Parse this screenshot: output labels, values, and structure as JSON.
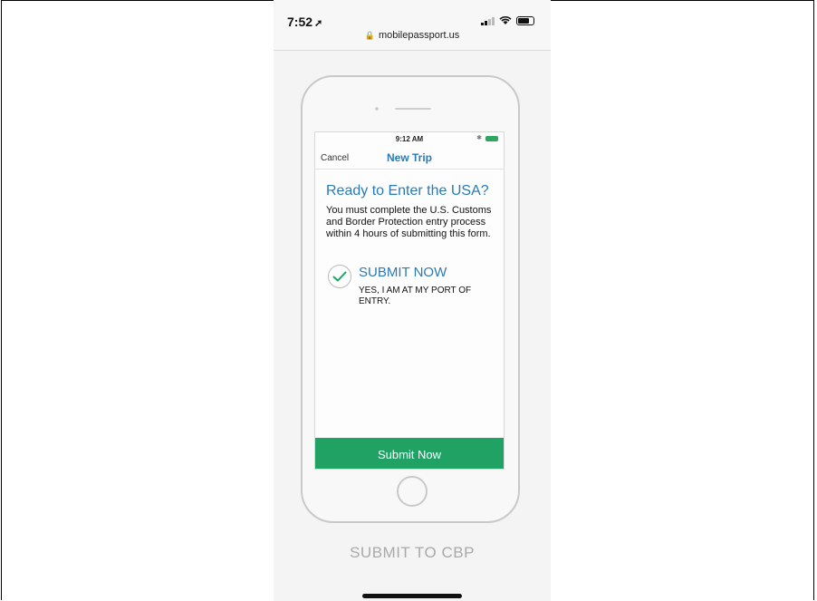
{
  "status_bar": {
    "time": "7:52",
    "location_icon": "location-arrow-icon",
    "url": "mobilepassport.us"
  },
  "inner_app": {
    "time": "9:12 AM",
    "nav_cancel": "Cancel",
    "nav_title": "New Trip",
    "heading": "Ready to Enter the USA?",
    "description": "You must complete the U.S. Customs and Border Protection entry process within 4 hours of submitting this form.",
    "option_title": "SUBMIT NOW",
    "option_subtitle": "YES, I AM AT MY PORT OF ENTRY.",
    "submit_button": "Submit Now",
    "accent_color": "#2a7bb3",
    "button_color": "#21a265"
  },
  "footer": {
    "caption": "SUBMIT TO CBP"
  }
}
